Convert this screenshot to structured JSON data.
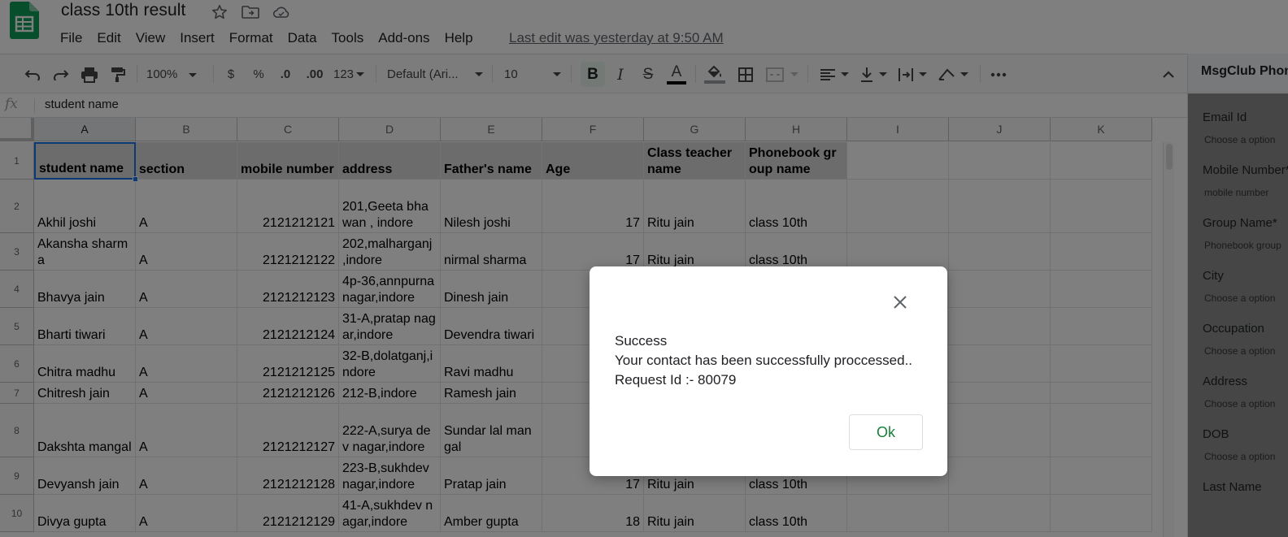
{
  "doc": {
    "title": "class 10th result",
    "last_edit": "Last edit was yesterday at 9:50 AM"
  },
  "menu": [
    "File",
    "Edit",
    "View",
    "Insert",
    "Format",
    "Data",
    "Tools",
    "Add-ons",
    "Help"
  ],
  "toolbar": {
    "zoom": "100%",
    "currency": "$",
    "percent": "%",
    "decrease_decimal": ".0",
    "increase_decimal": ".00",
    "more_formats": "123",
    "font": "Default (Ari...",
    "font_size": "10",
    "bold": "B",
    "italic": "I",
    "strikethrough": "S",
    "text_color": "A"
  },
  "formula_bar": {
    "fx": "fx",
    "value": "student name"
  },
  "columns": [
    "A",
    "B",
    "C",
    "D",
    "E",
    "F",
    "G",
    "H",
    "I",
    "J",
    "K"
  ],
  "rows": [
    "1",
    "2",
    "3",
    "4",
    "5",
    "6",
    "7",
    "8",
    "9",
    "10"
  ],
  "table": {
    "headers": [
      "student name",
      "section",
      "mobile number",
      "address",
      "Father's name",
      "Age",
      "Class teacher name",
      "Phonebook group name"
    ],
    "rows": [
      [
        "Akhil joshi",
        "A",
        "2121212121",
        "201,Geeta bhawan , indore",
        "Nilesh joshi",
        "17",
        "Ritu jain",
        "class 10th"
      ],
      [
        "Akansha sharma",
        "A",
        "2121212122",
        "202,malharganj ,indore",
        "nirmal sharma",
        "17",
        "Ritu jain",
        "class 10th"
      ],
      [
        "Bhavya jain",
        "A",
        "2121212123",
        "4p-36,annpurna nagar,indore",
        "Dinesh jain",
        "",
        "",
        ""
      ],
      [
        "Bharti tiwari",
        "A",
        "2121212124",
        "31-A,pratap nagar,indore",
        "Devendra tiwari",
        "",
        "",
        ""
      ],
      [
        "Chitra madhu",
        "A",
        "2121212125",
        "32-B,dolatganj,indore",
        "Ravi madhu",
        "",
        "",
        ""
      ],
      [
        "Chitresh jain",
        "A",
        "2121212126",
        "212-B,indore",
        "Ramesh jain",
        "",
        "",
        ""
      ],
      [
        "Dakshta mangal",
        "A",
        "2121212127",
        "222-A,surya dev nagar,indore",
        "Sundar lal mangal",
        "",
        "",
        ""
      ],
      [
        "Devyansh jain",
        "A",
        "2121212128",
        "223-B,sukhdev nagar,indore",
        "Pratap jain",
        "17",
        "Ritu jain",
        "class 10th"
      ],
      [
        "Divya gupta",
        "A",
        "2121212129",
        "41-A,sukhdev nagar,indore",
        "Amber gupta",
        "18",
        "Ritu jain",
        "class 10th"
      ]
    ]
  },
  "side_panel": {
    "title": "MsgClub Phonebook",
    "fields": [
      {
        "label": "Email Id",
        "placeholder": "Choose a option"
      },
      {
        "label": "Mobile Number*",
        "placeholder": "mobile number"
      },
      {
        "label": "Group Name*",
        "placeholder": "Phonebook group"
      },
      {
        "label": "City",
        "placeholder": "Choose a option"
      },
      {
        "label": "Occupation",
        "placeholder": "Choose a option"
      },
      {
        "label": "Address",
        "placeholder": "Choose a option"
      },
      {
        "label": "DOB",
        "placeholder": "Choose a option"
      },
      {
        "label": "Last Name",
        "placeholder": ""
      }
    ]
  },
  "dialog": {
    "line1": "Success",
    "line2": "Your contact has been successfully proccessed..",
    "line3": "Request Id :- 80079",
    "ok_label": "Ok"
  },
  "colors": {
    "accent": "#1a73e8",
    "ok_text": "#188038",
    "sheets_green": "#0f9d58"
  }
}
